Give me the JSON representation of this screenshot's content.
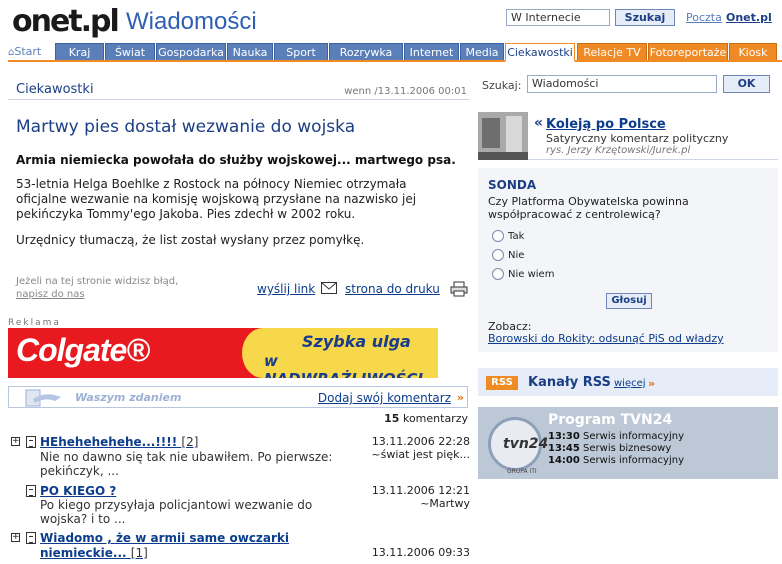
{
  "header": {
    "logo": "onet.pl",
    "section_title": "Wiadomości",
    "search_value": "W Internecie",
    "search_button": "Szukaj",
    "mail_link": "Poczta",
    "onet_link": "Onet.pl"
  },
  "tabs": [
    {
      "label": "Start"
    },
    {
      "label": "Kraj"
    },
    {
      "label": "Świat"
    },
    {
      "label": "Gospodarka"
    },
    {
      "label": "Nauka"
    },
    {
      "label": "Sport"
    },
    {
      "label": "Rozrywka"
    },
    {
      "label": "Internet"
    },
    {
      "label": "Media"
    },
    {
      "label": "Ciekawostki"
    },
    {
      "label": "Relacje TV"
    },
    {
      "label": "Fotoreportaże"
    },
    {
      "label": "Kiosk"
    }
  ],
  "article": {
    "category": "Ciekawostki",
    "meta": "wenn /13.11.2006 00:01",
    "title": "Martwy pies dostał wezwanie do wojska",
    "lead": "Armia niemiecka powołała do służby wojskowej... martwego psa.",
    "p1": "53-letnia Helga Boehlke z Rostock na północy Niemiec otrzymała oficjalne wezwanie na komisję wojskową przysłane na nazwisko jej pekińczyka Tommy'ego Jakoba. Pies zdechł w 2002 roku.",
    "p2": "Urzędnicy tłumaczą, że list został wysłany przez pomyłkę.",
    "error_note_line1": "Jeżeli na tej stronie widzisz błąd,",
    "error_note_link": "napisz do nas",
    "send_link": "wyślij link",
    "print_link": "strona do druku"
  },
  "ad": {
    "label": "Reklama",
    "brand": "Colgate®",
    "line1": "Szybka ulga",
    "line2": "w NADWRAŻLIWOŚCI"
  },
  "comments": {
    "bar_label": "Waszym zdaniem",
    "add_link": "Dodaj swój komentarz",
    "count": "15",
    "count_label": "komentarzy",
    "items": [
      {
        "title": "HEhehehehehe...!!!!",
        "count": "[2]",
        "snippet": "Nie no dawno się tak nie ubawiłem. Po pierwsze: pekińczyk, ...",
        "date": "13.11.2006 22:28",
        "author": "~świat jest pięk..."
      },
      {
        "title": "PO KIEGO ?",
        "count": "",
        "snippet": "Po kiego przysyłaja policjantowi wezwanie do wojska? i to ...",
        "date": "13.11.2006 12:21",
        "author": "~Martwy"
      },
      {
        "title": "Wiadomo , że w armii same owczarki niemieckie...",
        "count": "[1]",
        "snippet": "",
        "date": "13.11.2006 09:33",
        "author": ""
      }
    ]
  },
  "right": {
    "search_label": "Szukaj:",
    "search_value": "Wiadomości",
    "search_button": "OK",
    "promo_quote": "«",
    "promo_title": "Koleją po Polsce",
    "promo_desc": "Satyryczny komentarz polityczny",
    "promo_credit": "rys. Jerzy Krzętowski/Jurek.pl",
    "sonda": {
      "title": "SONDA",
      "question": "Czy Platforma Obywatelska powinna współpracować z centrolewicą?",
      "options": [
        "Tak",
        "Nie",
        "Nie wiem"
      ],
      "button": "Głosuj",
      "see": "Zobacz:",
      "link": "Borowski do Rokity: odsunąć PiS od władzy"
    },
    "rss": {
      "badge": "RSS",
      "title": "Kanały RSS",
      "more": "więcej",
      "arrow": "»"
    },
    "tvn": {
      "logo": "tvn24",
      "group": "GRUPA ITI",
      "title": "Program TVN24",
      "rows": [
        {
          "time": "13:30",
          "name": "Serwis informacyjny"
        },
        {
          "time": "13:45",
          "name": "Serwis biznesowy"
        },
        {
          "time": "14:00",
          "name": "Serwis informacyjny"
        }
      ]
    }
  },
  "colors": {
    "brand_blue": "#1b3e85",
    "tab_blue": "#5b7fb9",
    "accent_orange": "#f08a24",
    "ad_red": "#e8191f"
  }
}
